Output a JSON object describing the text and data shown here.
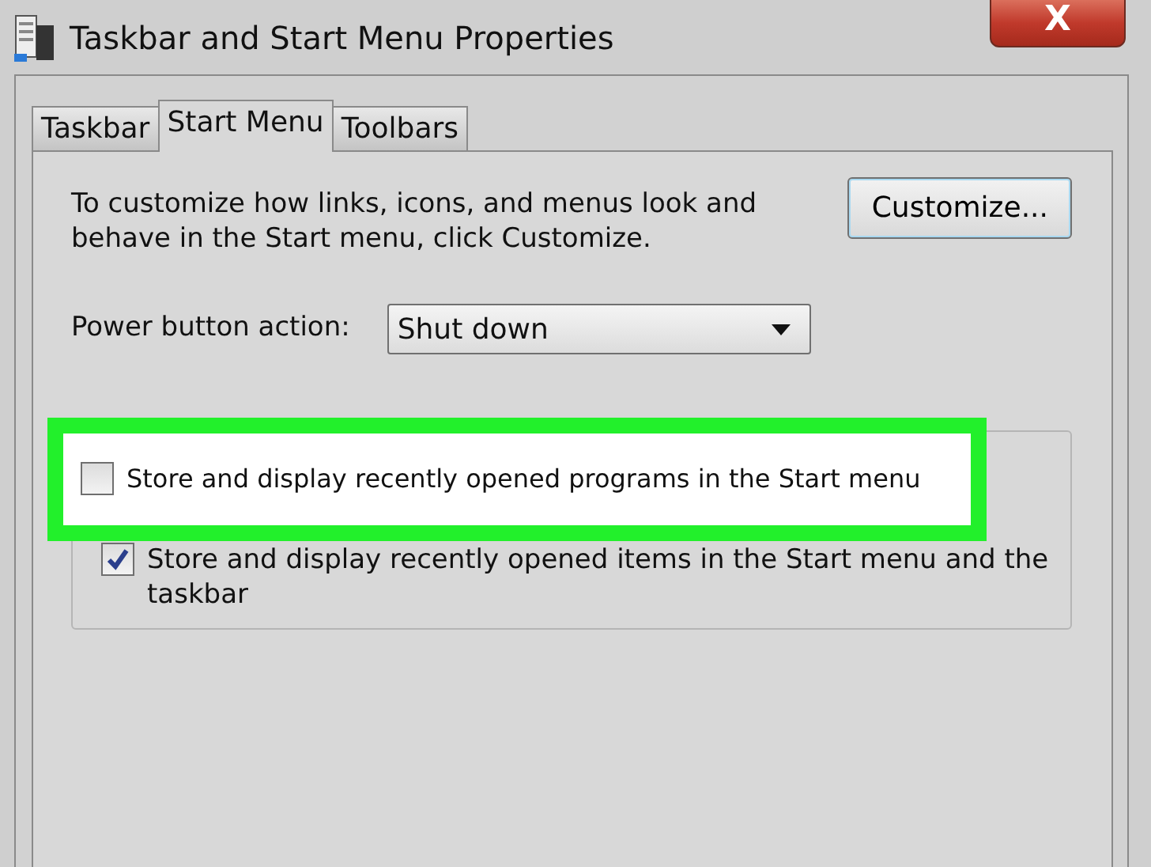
{
  "window": {
    "title": "Taskbar and Start Menu Properties",
    "close_label": "X"
  },
  "tabs": [
    {
      "label": "Taskbar",
      "selected": false
    },
    {
      "label": "Start Menu",
      "selected": true
    },
    {
      "label": "Toolbars",
      "selected": false
    }
  ],
  "description": "To customize how links, icons, and menus look and behave in the Start menu, click Customize.",
  "customize_button": "Customize...",
  "power_button": {
    "label": "Power button action:",
    "value": "Shut down"
  },
  "privacy": {
    "options": [
      {
        "label": "Store and display recently opened programs in the Start menu",
        "checked": false,
        "highlighted": true
      },
      {
        "label": "Store and display recently opened items in the Start menu and the taskbar",
        "checked": true,
        "highlighted": false
      }
    ]
  }
}
